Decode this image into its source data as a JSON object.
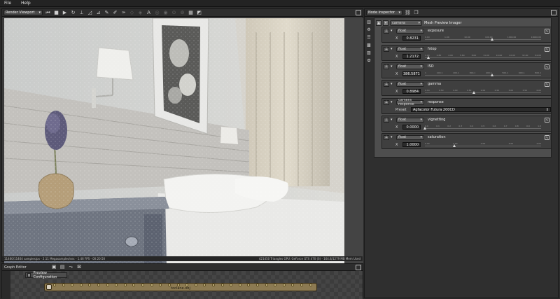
{
  "menu": {
    "file": "File",
    "help": "Help"
  },
  "viewport": {
    "select_label": "Render Viewport",
    "status_left": "11460/11464 samples/px - 2.11 Megasamples/sec - 1.46 FPS - 00:20:50",
    "status_right": "421450 Triangles   GPU: GeForce GTX 470 (6) - 164.8/1279 MB Mem Used"
  },
  "graph_editor": {
    "title": "Graph Editor",
    "preview_config": "Preview Configuration",
    "mesh_node_label": "toclane.obj",
    "pin_count": 30
  },
  "inspector": {
    "select_label": "Node Inspector",
    "node_type": "camera",
    "node_name": "Mesh Preview Imager",
    "params": [
      {
        "type": "float",
        "name": "exposure",
        "value": "0.8231",
        "fraction": 0.58,
        "ticks": [
          "0.10",
          "1.00",
          "10.00",
          "100.00",
          "1000.00",
          "10000.00"
        ]
      },
      {
        "type": "float",
        "name": "fstop",
        "value": "1.2172",
        "fraction": 0.03,
        "ticks": [
          "1.00",
          "2.80",
          "4.00",
          "5.60",
          "8.00",
          "11.00",
          "16.00",
          "22.00",
          "32.00",
          "64.00"
        ]
      },
      {
        "type": "float",
        "name": "ISO",
        "value": "386.5871",
        "fraction": 0.58,
        "ticks": [
          "1",
          "100.1",
          "200.1",
          "300.1",
          "400.1",
          "500.1",
          "600.1",
          "800.1"
        ]
      },
      {
        "type": "float",
        "name": "gamma",
        "value": "0.8984",
        "fraction": 0.42,
        "ticks": [
          "0.10",
          "0.50",
          "1.00",
          "1.50",
          "2.00",
          "2.50",
          "3.00",
          "3.50",
          "4.00"
        ]
      },
      {
        "type": "camera response",
        "name": "response",
        "preset_label": "Preset",
        "preset_value": "Agfacolor Futura 200CD"
      },
      {
        "type": "float",
        "name": "vignetting",
        "value": "0.0000",
        "fraction": 0.0,
        "ticks": [
          "0.0",
          "0.1",
          "0.2",
          "0.3",
          "0.4",
          "0.5",
          "0.6",
          "0.7",
          "0.8",
          "0.9",
          "1.0"
        ]
      },
      {
        "type": "float",
        "name": "saturation",
        "value": "1.0000",
        "fraction": 0.25,
        "ticks": [
          "0.00",
          "1.00",
          "2.00",
          "3.00",
          "4.00"
        ]
      }
    ]
  },
  "colors": {
    "panel": "#2f2f2f",
    "node": "#8c7a52",
    "param_bg": "#3f3f3f"
  }
}
